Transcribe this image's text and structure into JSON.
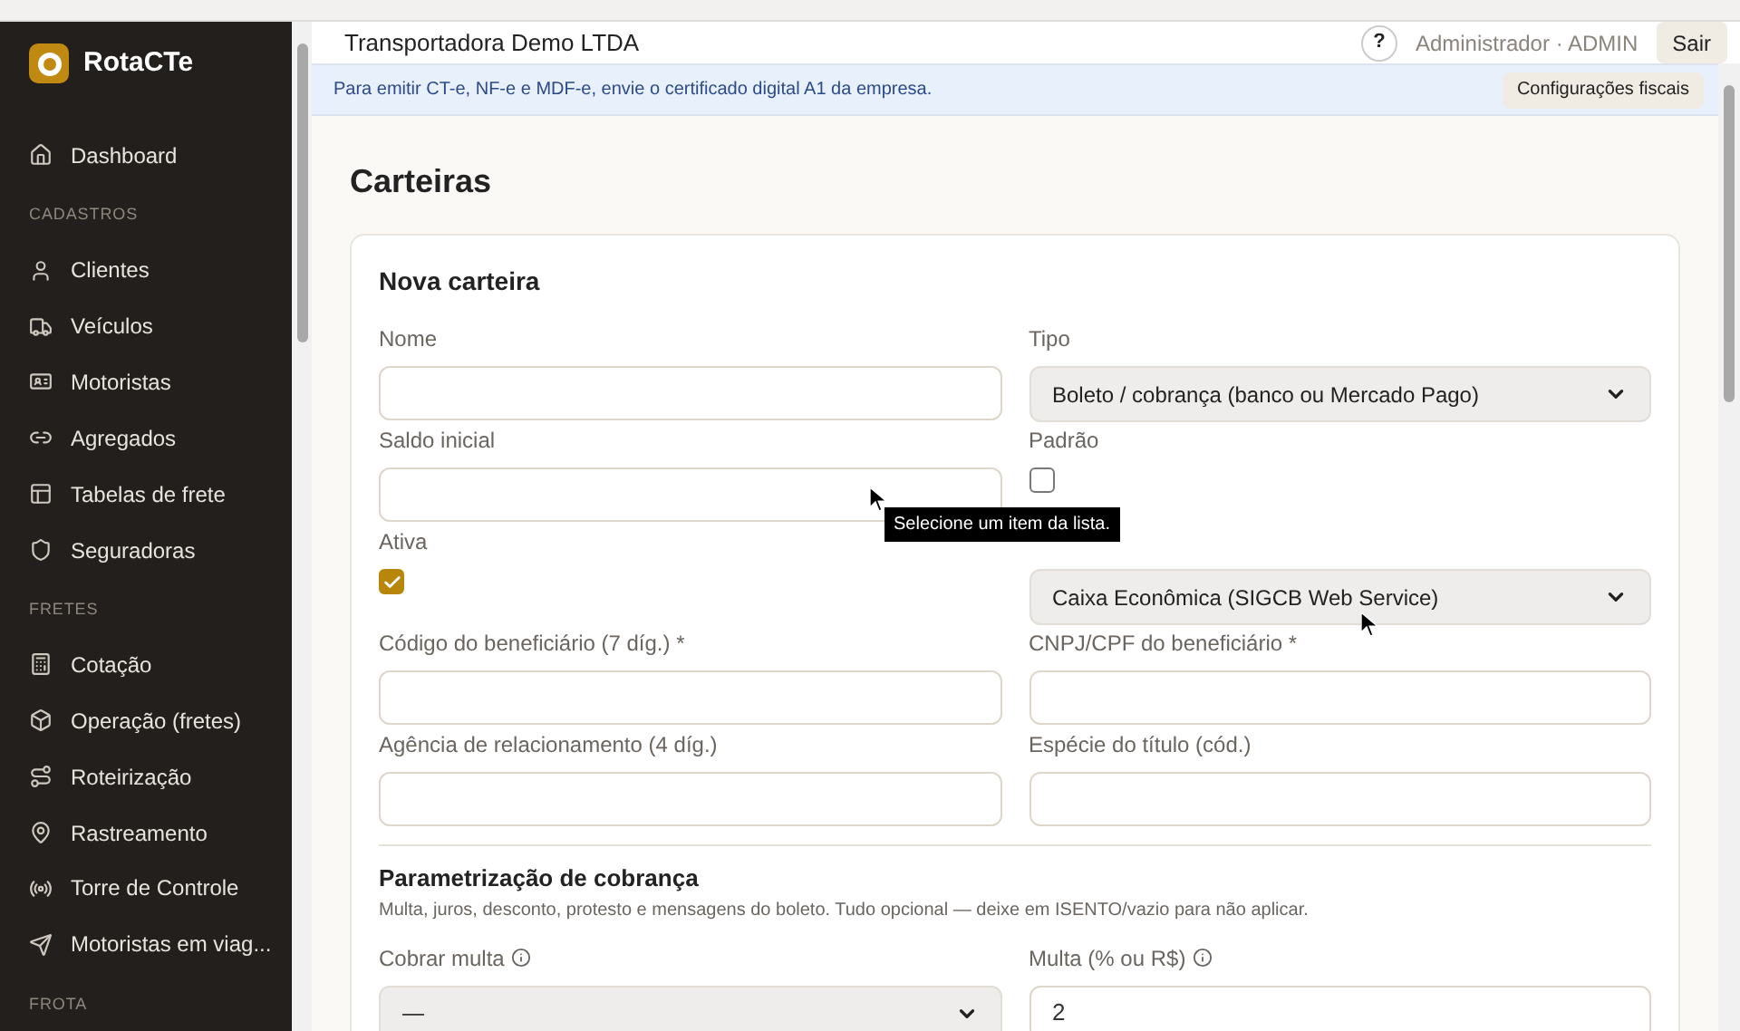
{
  "brand": {
    "name": "RotaCTe"
  },
  "sidebar": {
    "items": [
      {
        "kind": "link",
        "label": "Dashboard"
      },
      {
        "kind": "section",
        "label": "CADASTROS"
      },
      {
        "kind": "link",
        "label": "Clientes"
      },
      {
        "kind": "link",
        "label": "Veículos"
      },
      {
        "kind": "link",
        "label": "Motoristas"
      },
      {
        "kind": "link",
        "label": "Agregados"
      },
      {
        "kind": "link",
        "label": "Tabelas de frete"
      },
      {
        "kind": "link",
        "label": "Seguradoras"
      },
      {
        "kind": "section",
        "label": "FRETES"
      },
      {
        "kind": "link",
        "label": "Cotação"
      },
      {
        "kind": "link",
        "label": "Operação (fretes)"
      },
      {
        "kind": "link",
        "label": "Roteirização"
      },
      {
        "kind": "link",
        "label": "Rastreamento"
      },
      {
        "kind": "link",
        "label": "Torre de Controle"
      },
      {
        "kind": "link",
        "label": "Motoristas em viag..."
      },
      {
        "kind": "section",
        "label": "FROTA"
      }
    ]
  },
  "header": {
    "company": "Transportadora Demo LTDA",
    "help": "?",
    "user": "Administrador · ADMIN",
    "logout": "Sair"
  },
  "banner": {
    "text": "Para emitir CT-e, NF-e e MDF-e, envie o certificado digital A1 da empresa.",
    "button": "Configurações fiscais"
  },
  "page_title": "Carteiras",
  "card": {
    "title": "Nova carteira",
    "fields": [
      {
        "kind": "input",
        "label": "Nome"
      },
      {
        "kind": "select",
        "label": "Tipo",
        "value": "Boleto / cobrança (banco ou Mercado Pago)"
      },
      {
        "kind": "input",
        "label": "Saldo inicial"
      },
      {
        "kind": "checkbox",
        "label": "Padrão",
        "checked": false
      },
      {
        "kind": "checkbox",
        "label": "Ativa",
        "checked": true
      },
      {
        "kind": "select",
        "value": "Caixa Econômica (SIGCB Web Service)"
      },
      {
        "kind": "input",
        "label": "Código do beneficiário (7 díg.) *"
      },
      {
        "kind": "input",
        "label": "CNPJ/CPF do beneficiário *"
      },
      {
        "kind": "input",
        "label": "Agência de relacionamento (4 díg.)"
      },
      {
        "kind": "input",
        "label": "Espécie do título (cód.)"
      }
    ],
    "section": {
      "title": "Parametrização de cobrança",
      "description": "Multa, juros, desconto, protesto e mensagens do boleto. Tudo opcional — deixe em ISENTO/vazio para não aplicar.",
      "fields": [
        {
          "kind": "select",
          "label": "Cobrar multa",
          "info": true,
          "value": "—"
        },
        {
          "kind": "input",
          "label": "Multa (% ou R$)",
          "info": true,
          "value": "2"
        }
      ]
    }
  },
  "tooltip": "Selecione um item da lista."
}
